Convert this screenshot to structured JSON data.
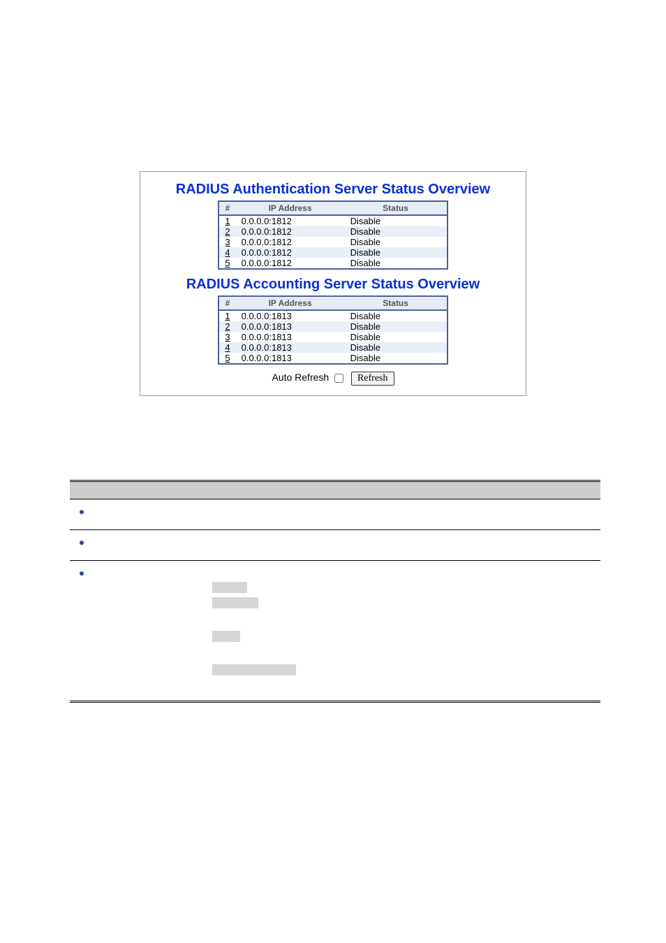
{
  "figure": {
    "heading1": "RADIUS Authentication Server Status Overview",
    "heading2": "RADIUS Accounting Server Status Overview",
    "cols": {
      "num": "#",
      "ip": "IP Address",
      "status": "Status"
    },
    "auth_rows": [
      {
        "n": "1",
        "ip": "0.0.0.0:1812",
        "status": "Disable"
      },
      {
        "n": "2",
        "ip": "0.0.0.0:1812",
        "status": "Disable"
      },
      {
        "n": "3",
        "ip": "0.0.0.0:1812",
        "status": "Disable"
      },
      {
        "n": "4",
        "ip": "0.0.0.0:1812",
        "status": "Disable"
      },
      {
        "n": "5",
        "ip": "0.0.0.0:1812",
        "status": "Disable"
      }
    ],
    "acct_rows": [
      {
        "n": "1",
        "ip": "0.0.0.0:1813",
        "status": "Disable"
      },
      {
        "n": "2",
        "ip": "0.0.0.0:1813",
        "status": "Disable"
      },
      {
        "n": "3",
        "ip": "0.0.0.0:1813",
        "status": "Disable"
      },
      {
        "n": "4",
        "ip": "0.0.0.0:1813",
        "status": "Disable"
      },
      {
        "n": "5",
        "ip": "0.0.0.0:1813",
        "status": "Disable"
      }
    ],
    "auto_refresh_label": "Auto Refresh",
    "refresh_btn": "Refresh"
  }
}
